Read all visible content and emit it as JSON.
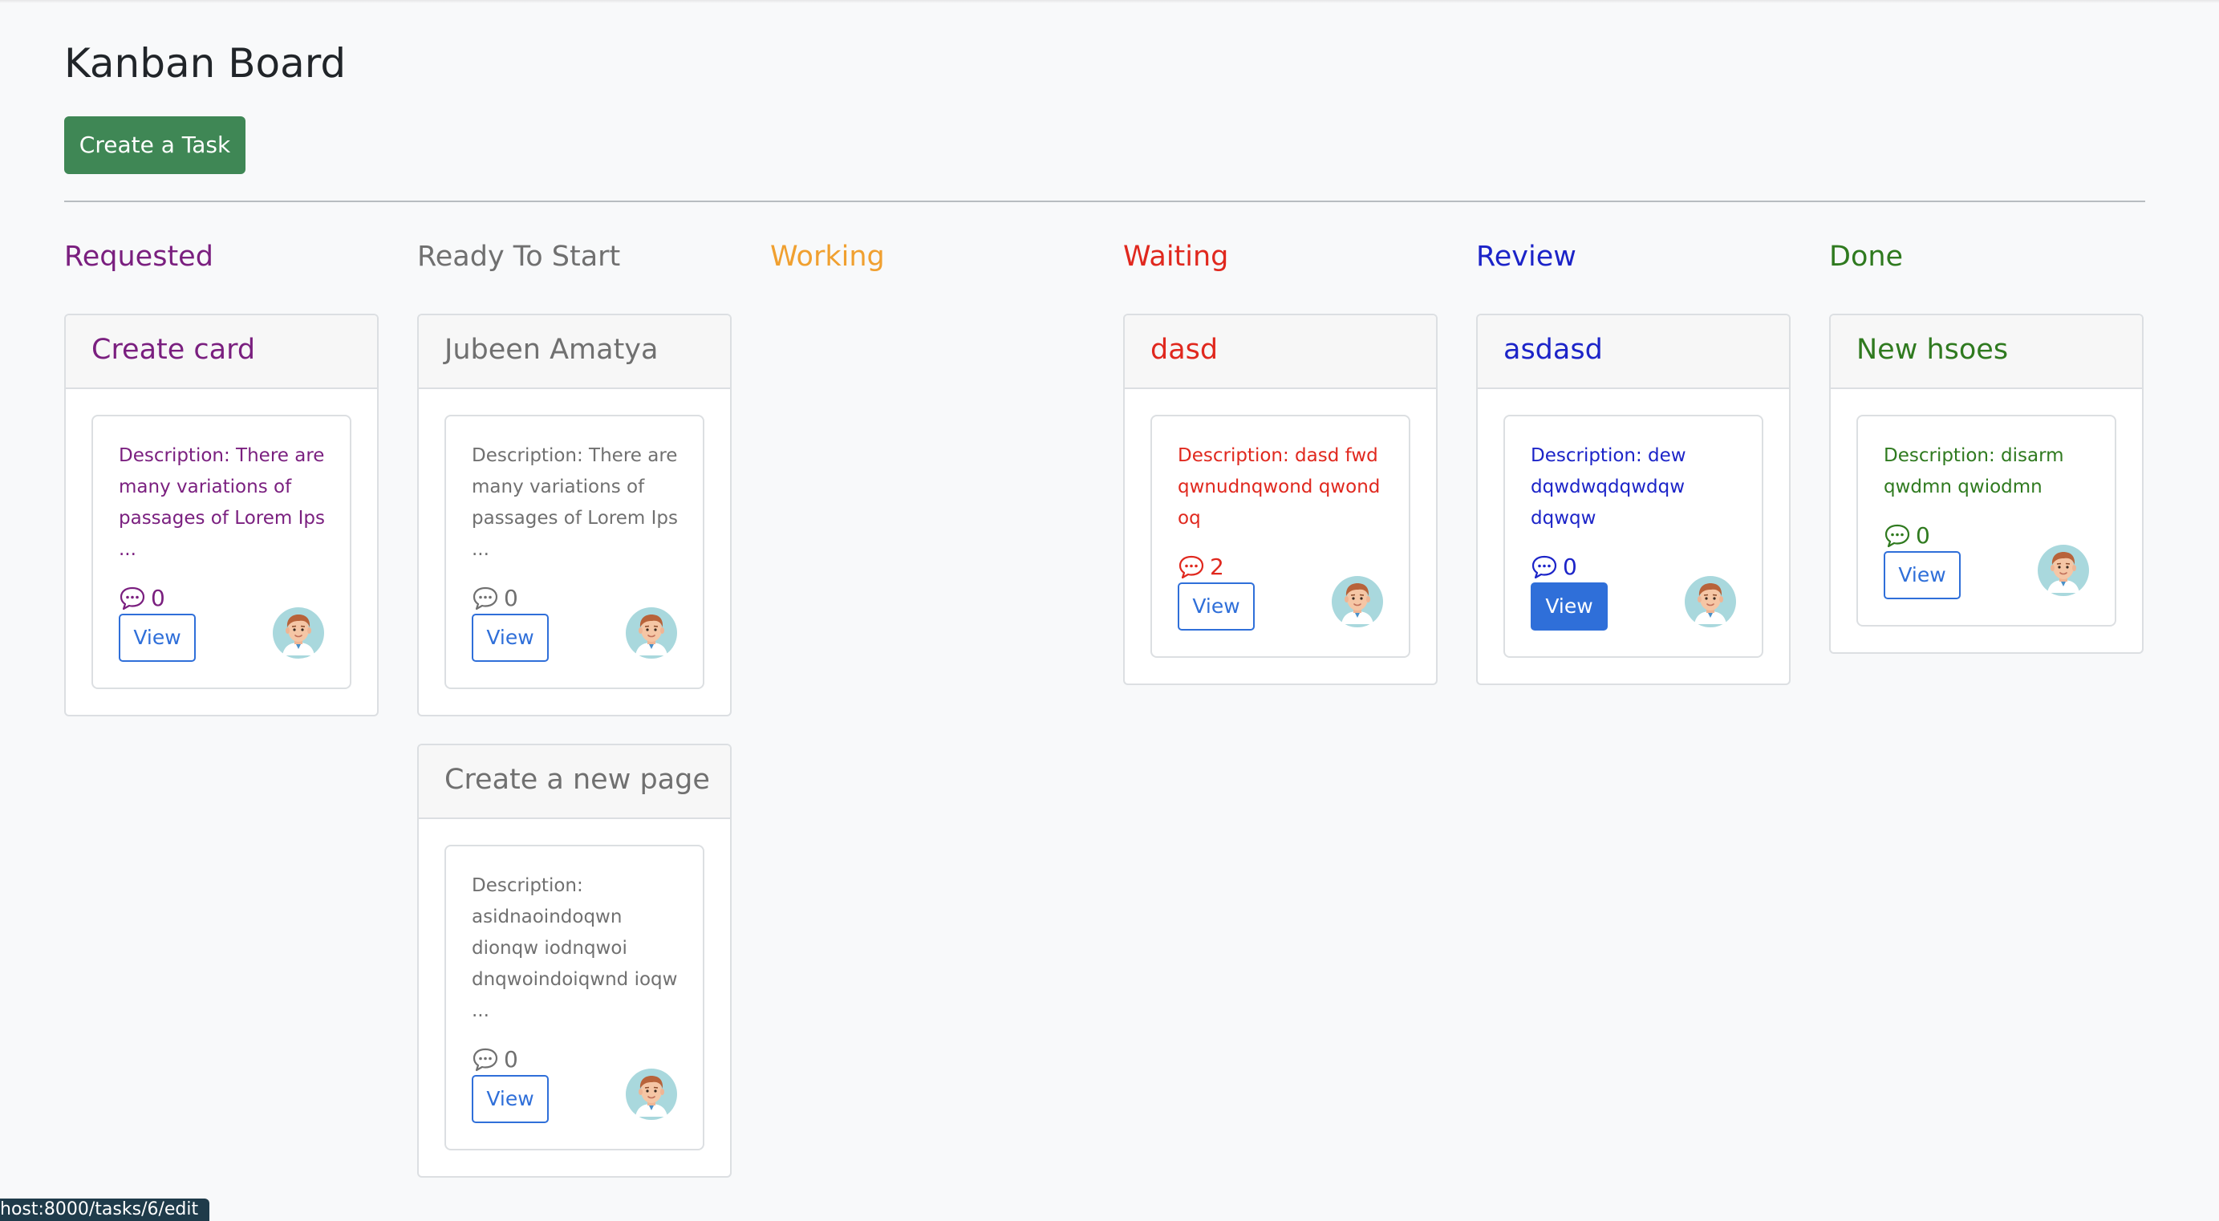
{
  "page": {
    "title": "Kanban Board",
    "create_button": "Create a Task"
  },
  "columns": [
    {
      "title": "Requested",
      "color": "#7a1f7f",
      "tasks": [
        {
          "title": "Create card",
          "description_lines": [
            "Description: There are",
            "many variations of",
            "passages of Lorem Ips",
            "..."
          ],
          "comments": "0",
          "view_label": "View",
          "view_active": false
        }
      ]
    },
    {
      "title": "Ready To Start",
      "color": "#707070",
      "tasks": [
        {
          "title": "Jubeen Amatya",
          "description_lines": [
            "Description: There are",
            "many variations of",
            "passages of Lorem Ips",
            "..."
          ],
          "comments": "0",
          "view_label": "View",
          "view_active": false
        },
        {
          "title": "Create a new page",
          "description_lines": [
            "Description:",
            "asidnaoindoqwn",
            "dionqw iodnqwoi",
            "dnqwoindoiqwnd ioqw",
            "..."
          ],
          "comments": "0",
          "view_label": "View",
          "view_active": false
        }
      ]
    },
    {
      "title": "Working",
      "color": "#f0a030",
      "tasks": []
    },
    {
      "title": "Waiting",
      "color": "#e0281e",
      "tasks": [
        {
          "title": "dasd",
          "description_lines": [
            "Description: dasd fwd",
            "qwnudnqwond qwond",
            "oq"
          ],
          "comments": "2",
          "view_label": "View",
          "view_active": false
        }
      ]
    },
    {
      "title": "Review",
      "color": "#1c24c8",
      "tasks": [
        {
          "title": "asdasd",
          "description_lines": [
            "Description: dew",
            "dqwdwqdqwdqw",
            "dqwqw"
          ],
          "comments": "0",
          "view_label": "View",
          "view_active": true
        }
      ]
    },
    {
      "title": "Done",
      "color": "#2f7a1f",
      "tasks": [
        {
          "title": "New hsoes",
          "description_lines": [
            "Description: disarm",
            "qwdmn qwiodmn"
          ],
          "comments": "0",
          "view_label": "View",
          "view_active": false
        }
      ]
    }
  ],
  "status_bar": {
    "url": "host:8000/tasks/6/edit"
  },
  "icons": {
    "comment": "speech-bubble-icon",
    "avatar": "user-avatar-icon"
  }
}
